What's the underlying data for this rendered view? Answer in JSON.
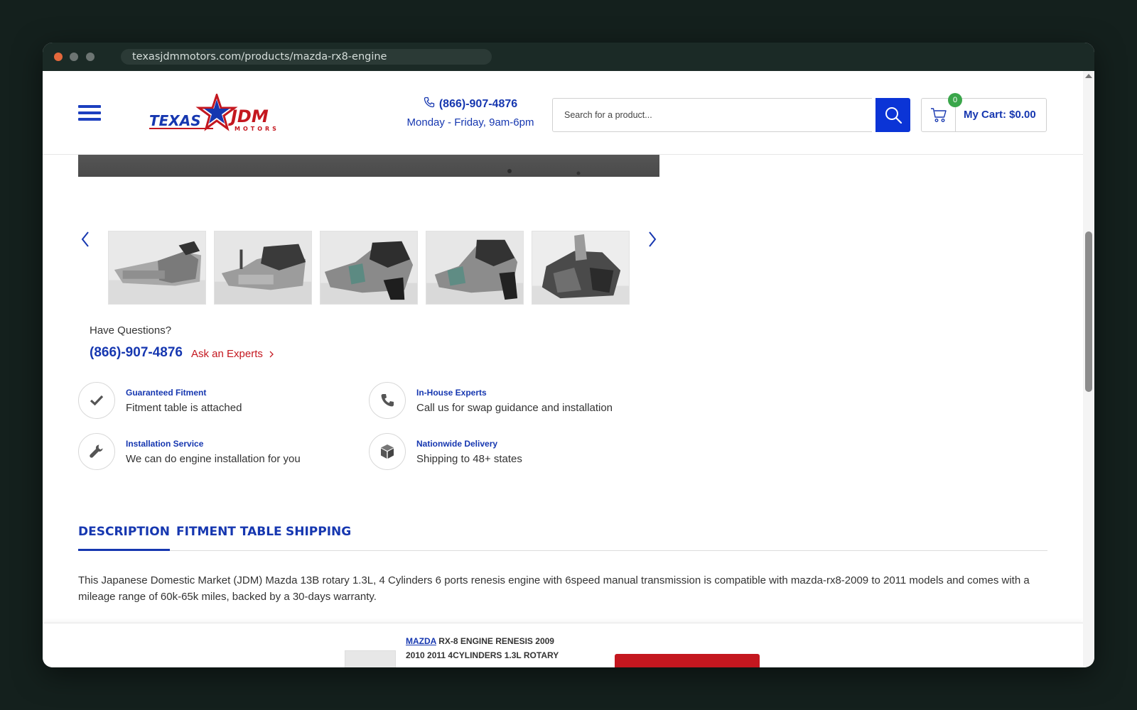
{
  "browser": {
    "url": "texasjdmmotors.com/products/mazda-rx8-engine"
  },
  "header": {
    "logo_text_left": "TEXAS",
    "logo_text_right": "JDM",
    "logo_sub": "MOTORS",
    "phone": "(866)-907-4876",
    "hours": "Monday - Friday, 9am-6pm",
    "search_placeholder": "Search for a product...",
    "cart_count": "0",
    "cart_label": "My Cart: $0.00"
  },
  "questions": {
    "title": "Have Questions?",
    "phone": "(866)-907-4876",
    "ask_label": "Ask an Experts"
  },
  "features": [
    {
      "title": "Guaranteed Fitment",
      "desc": "Fitment table is attached",
      "icon": "checkmark-icon"
    },
    {
      "title": "In-House Experts",
      "desc": "Call us for swap guidance and installation",
      "icon": "phone-icon"
    },
    {
      "title": "Installation Service",
      "desc": "We can do engine installation for you",
      "icon": "wrench-icon"
    },
    {
      "title": "Nationwide Delivery",
      "desc": "Shipping to 48+ states",
      "icon": "box-icon"
    }
  ],
  "tabs": [
    {
      "label": "DESCRIPTION",
      "active": true
    },
    {
      "label": "FITMENT TABLE",
      "active": false
    },
    {
      "label": "SHIPPING",
      "active": false
    }
  ],
  "description": "This Japanese Domestic Market (JDM) Mazda 13B rotary 1.3L, 4 Cylinders 6 ports renesis engine with 6speed manual transmission is compatible with mazda-rx8-2009 to 2011 models and comes with a mileage range of 60k-65k miles, backed by a 30-days warranty.",
  "sticky_bar": {
    "brand_link": "MAZDA",
    "title": "RX-8 ENGINE RENESIS 2009",
    "title_line2": "2010 2011 4CYLINDERS 1.3L ROTARY"
  },
  "colors": {
    "brand_blue": "#1637b0",
    "search_blue": "#0b34d6",
    "accent_red": "#c4171f",
    "badge_green": "#3aa64a"
  }
}
